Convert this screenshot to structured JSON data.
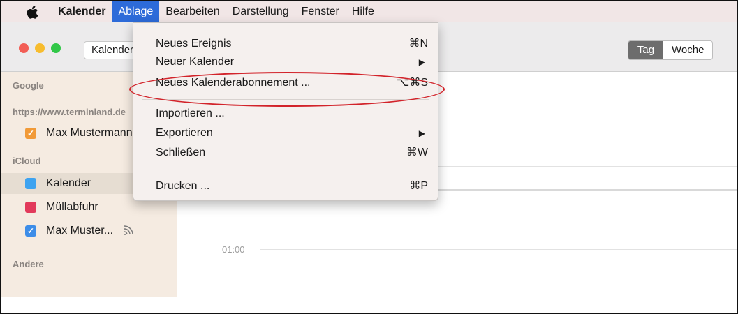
{
  "menubar": {
    "apple_icon": "apple-icon",
    "app_name": "Kalender",
    "menus": [
      "Ablage",
      "Bearbeiten",
      "Darstellung",
      "Fenster",
      "Hilfe"
    ]
  },
  "toolbar": {
    "calendars_button": "Kalender",
    "view_segments": {
      "day": "Tag",
      "week": "Woche"
    }
  },
  "sidebar": {
    "groups": {
      "google": "Google",
      "terminland": "https://www.terminland.de",
      "icloud": "iCloud",
      "other": "Andere"
    },
    "items": {
      "max_mustermann": "Max Mustermann",
      "kalender": "Kalender",
      "muellabfuhr": "Müllabfuhr",
      "max_muster_shared": "Max Muster..."
    },
    "colors": {
      "orange": "#f19a38",
      "blue": "#3ea3f0",
      "red": "#e23a5b",
      "checkblue": "#3d8de8"
    }
  },
  "main": {
    "time_0100": "01:00"
  },
  "dropdown": {
    "items": [
      {
        "label": "Neues Ereignis",
        "shortcut": "⌘N"
      },
      {
        "label": "Neuer Kalender",
        "submenu": "▶"
      },
      {
        "label": "Neues Kalenderabonnement ...",
        "shortcut": "⌥⌘S"
      },
      {
        "label": "Importieren ..."
      },
      {
        "label": "Exportieren",
        "submenu": "▶"
      },
      {
        "label": "Schließen",
        "shortcut": "⌘W"
      },
      {
        "label": "Drucken ...",
        "shortcut": "⌘P"
      }
    ]
  },
  "annotation": {
    "color": "#d2232a"
  }
}
